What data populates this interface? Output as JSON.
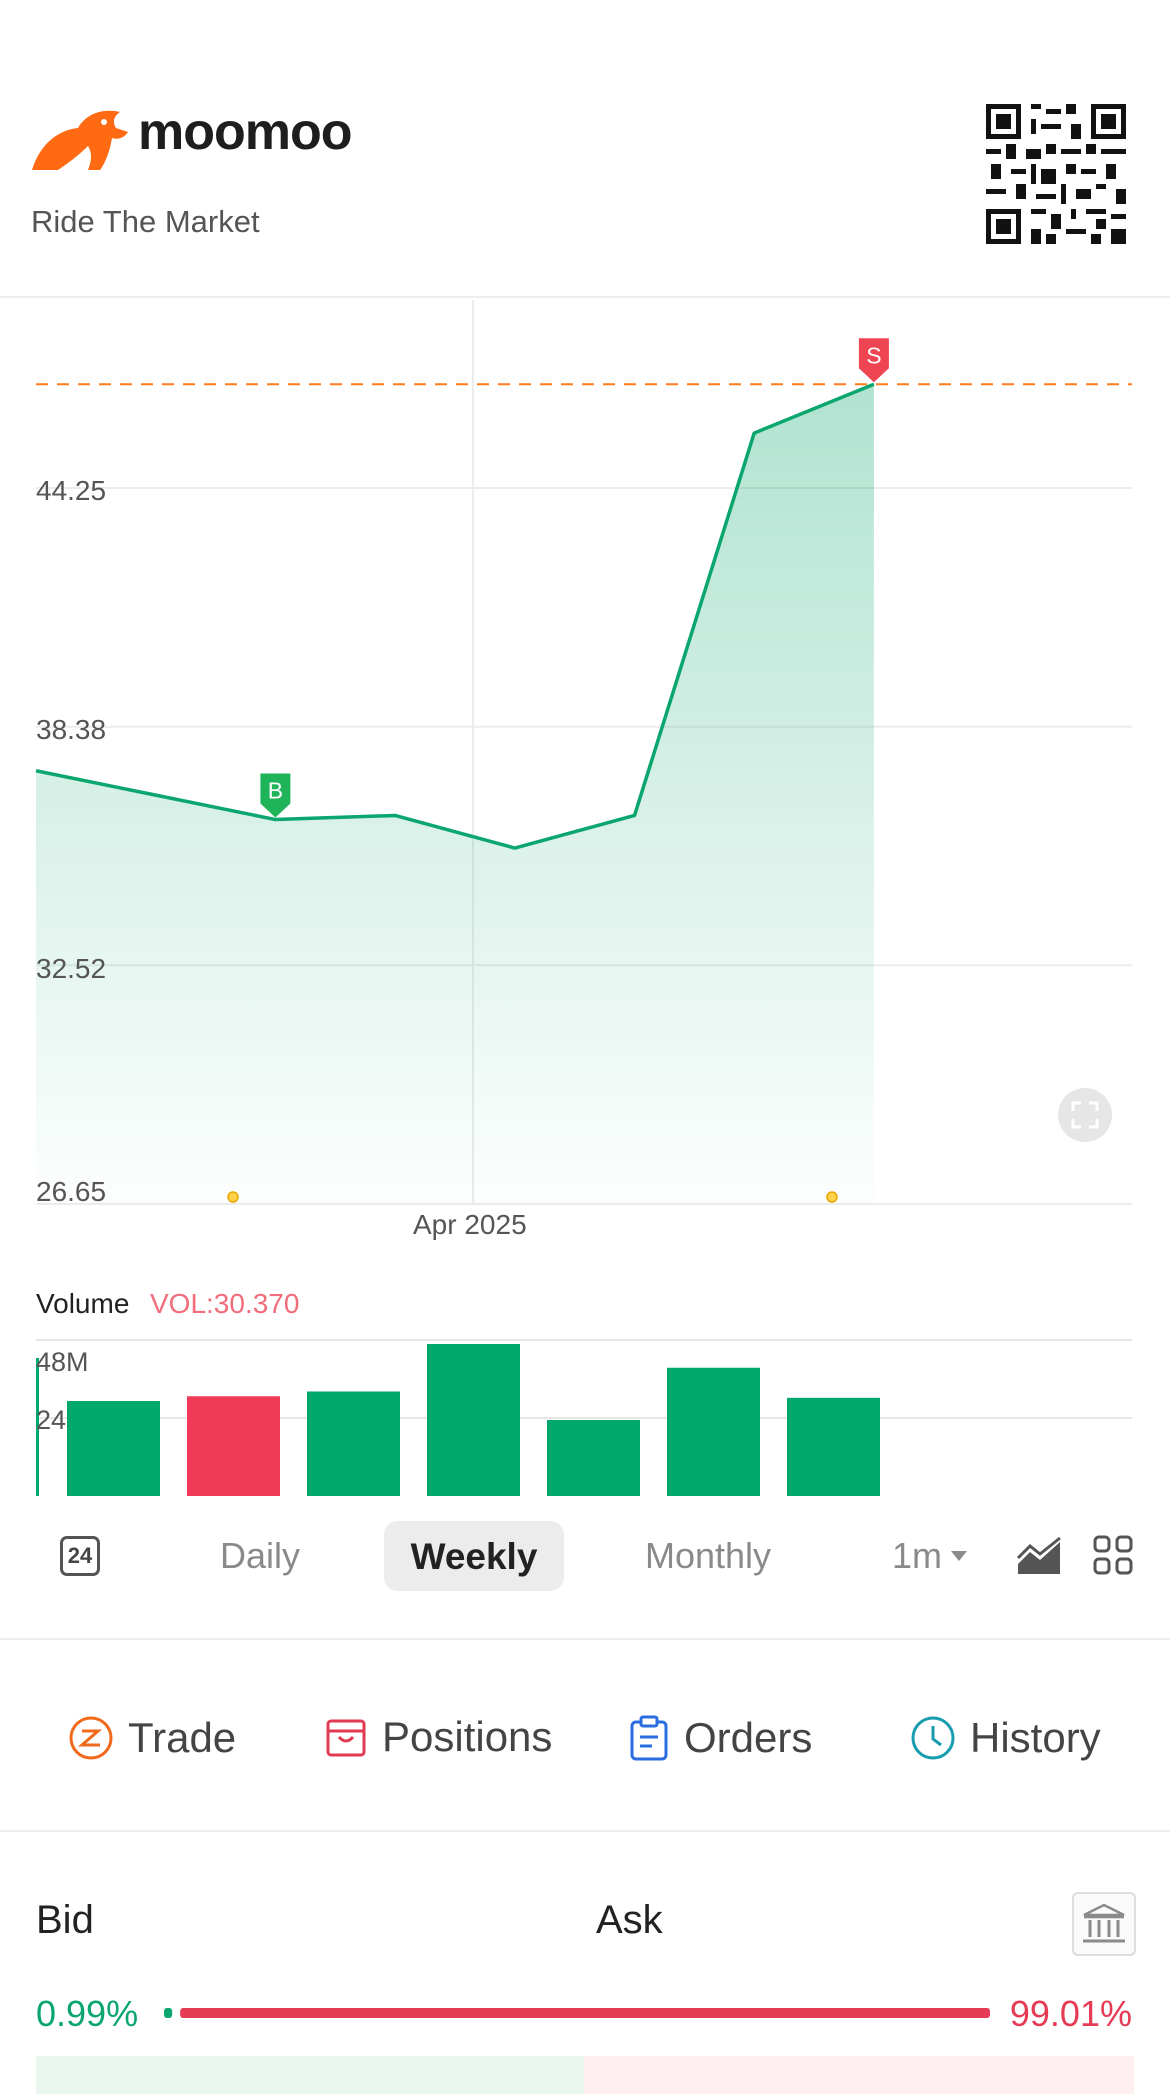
{
  "brand": {
    "name": "moomoo",
    "tagline": "Ride The Market",
    "color": "#ff6a13"
  },
  "price_chart": {
    "y_ticks": [
      "44.25",
      "38.38",
      "32.52",
      "26.65"
    ],
    "x_tick": "Apr 2025",
    "y_range": [
      26.65,
      47.5
    ],
    "points": [
      37.3,
      36.7,
      36.1,
      36.2,
      35.4,
      36.2,
      45.6,
      46.8
    ],
    "reference_line_value": 46.8,
    "buy_marker": {
      "label": "B",
      "index": 2
    },
    "sell_marker": {
      "label": "S",
      "index": 7
    },
    "line_color": "#0aa66e",
    "reference_color": "#ff7a1a"
  },
  "volume": {
    "title": "Volume",
    "value": "VOL:30.370",
    "ticks": [
      "48M",
      "24"
    ],
    "y_max": 48,
    "bars": [
      {
        "value": 30,
        "color": "#00a86b"
      },
      {
        "value": 31.5,
        "color": "#f03a58"
      },
      {
        "value": 33,
        "color": "#00a86b"
      },
      {
        "value": 48,
        "color": "#00a86b"
      },
      {
        "value": 24,
        "color": "#00a86b"
      },
      {
        "value": 40.5,
        "color": "#00a86b"
      },
      {
        "value": 31,
        "color": "#00a86b"
      }
    ]
  },
  "period_tabs": {
    "extended_hours": "24",
    "daily": "Daily",
    "weekly": "Weekly",
    "monthly": "Monthly",
    "range": "1m"
  },
  "actions": [
    {
      "label": "Trade",
      "icon": "trade-icon",
      "color": "#f06a1c"
    },
    {
      "label": "Positions",
      "icon": "positions-icon",
      "color": "#e03b52"
    },
    {
      "label": "Orders",
      "icon": "orders-icon",
      "color": "#2a6de0"
    },
    {
      "label": "History",
      "icon": "history-icon",
      "color": "#1a9cb0"
    }
  ],
  "order_book": {
    "bid_label": "Bid",
    "ask_label": "Ask",
    "bid_pct": "0.99%",
    "ask_pct": "99.01%",
    "bid_ratio": 0.0099,
    "bid_color": "#0aa66e",
    "ask_color": "#e63b55"
  }
}
